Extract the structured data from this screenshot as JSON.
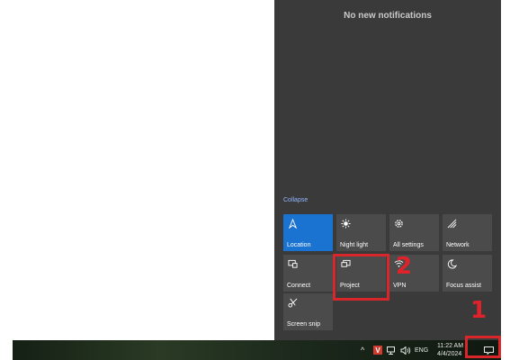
{
  "action_center": {
    "notifications_text": "No new notifications",
    "collapse_label": "Collapse",
    "tiles": [
      {
        "label": "Location",
        "icon": "location-icon",
        "active": true
      },
      {
        "label": "Night light",
        "icon": "night-light-icon",
        "active": false
      },
      {
        "label": "All settings",
        "icon": "gear-icon",
        "active": false
      },
      {
        "label": "Network",
        "icon": "network-icon",
        "active": false
      },
      {
        "label": "Connect",
        "icon": "connect-icon",
        "active": false
      },
      {
        "label": "Project",
        "icon": "project-icon",
        "active": false
      },
      {
        "label": "VPN",
        "icon": "vpn-icon",
        "active": false
      },
      {
        "label": "Focus assist",
        "icon": "moon-icon",
        "active": false
      },
      {
        "label": "Screen snip",
        "icon": "screen-snip-icon",
        "active": false
      }
    ]
  },
  "annotations": {
    "step1": "1",
    "step2": "2",
    "color": "#d8262b"
  },
  "taskbar": {
    "language": "ENG",
    "time": "11:22 AM",
    "date": "4/4/2024",
    "tray_app_letter": "V"
  },
  "colors": {
    "panel_bg": "#3a3a3a",
    "tile_bg": "#4b4b4b",
    "tile_active_bg": "#1a73d1"
  }
}
